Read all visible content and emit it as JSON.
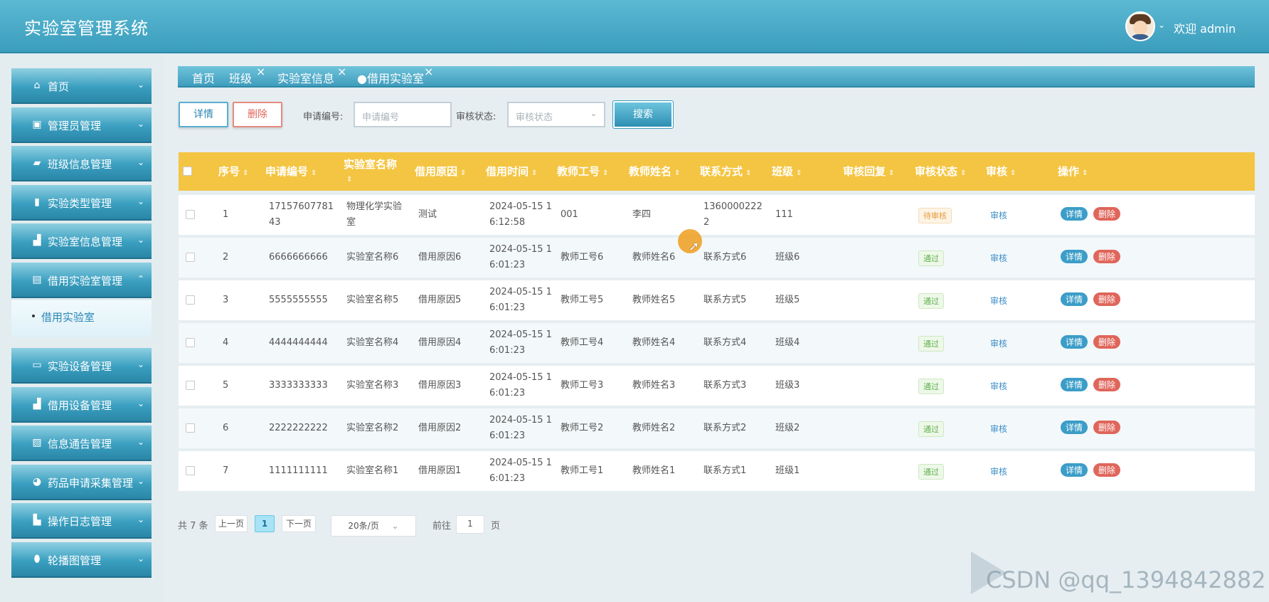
{
  "app": {
    "title": "实验室管理系统",
    "welcome": "欢迎 admin"
  },
  "sidebar": {
    "items": [
      {
        "label": "首页",
        "icon": "home-icon"
      },
      {
        "label": "管理员管理",
        "icon": "chip-icon"
      },
      {
        "label": "班级信息管理",
        "icon": "folder-icon"
      },
      {
        "label": "实验类型管理",
        "icon": "book-icon"
      },
      {
        "label": "实验室信息管理",
        "icon": "chart-icon"
      },
      {
        "label": "借用实验室管理",
        "icon": "panel-icon"
      },
      {
        "label": "实验设备管理",
        "icon": "toolbox-icon"
      },
      {
        "label": "借用设备管理",
        "icon": "chart-icon"
      },
      {
        "label": "信息通告管理",
        "icon": "image-icon"
      },
      {
        "label": "药品申请采集管理",
        "icon": "compass-icon"
      },
      {
        "label": "操作日志管理",
        "icon": "bar-icon"
      },
      {
        "label": "轮播图管理",
        "icon": "capsule-icon"
      }
    ],
    "submenu": "借用实验室"
  },
  "tabs": [
    "首页",
    "班级",
    "实验室信息",
    "借用实验室"
  ],
  "search": {
    "detail": "详情",
    "delete": "删除",
    "app_no_label": "申请编号:",
    "app_no_placeholder": "申请编号",
    "status_label": "审核状态:",
    "status_placeholder": "审核状态",
    "search": "搜索"
  },
  "table": {
    "headers": [
      "序号",
      "申请编号",
      "实验室名称",
      "借用原因",
      "借用时间",
      "教师工号",
      "教师姓名",
      "联系方式",
      "班级",
      "审核回复",
      "审核状态",
      "审核",
      "操作"
    ],
    "rows": [
      {
        "idx": "1",
        "no": "1715760778143",
        "lab": "物理化学实验室",
        "reason": "测试",
        "time": "2024-05-15 16:12:58",
        "tno": "001",
        "tname": "李四",
        "phone": "13600002222",
        "cls": "111",
        "reply": "",
        "status": "待审核",
        "audit": "审核"
      },
      {
        "idx": "2",
        "no": "6666666666",
        "lab": "实验室名称6",
        "reason": "借用原因6",
        "time": "2024-05-15 16:01:23",
        "tno": "教师工号6",
        "tname": "教师姓名6",
        "phone": "联系方式6",
        "cls": "班级6",
        "reply": "",
        "status": "通过",
        "audit": "审核"
      },
      {
        "idx": "3",
        "no": "5555555555",
        "lab": "实验室名称5",
        "reason": "借用原因5",
        "time": "2024-05-15 16:01:23",
        "tno": "教师工号5",
        "tname": "教师姓名5",
        "phone": "联系方式5",
        "cls": "班级5",
        "reply": "",
        "status": "通过",
        "audit": "审核"
      },
      {
        "idx": "4",
        "no": "4444444444",
        "lab": "实验室名称4",
        "reason": "借用原因4",
        "time": "2024-05-15 16:01:23",
        "tno": "教师工号4",
        "tname": "教师姓名4",
        "phone": "联系方式4",
        "cls": "班级4",
        "reply": "",
        "status": "通过",
        "audit": "审核"
      },
      {
        "idx": "5",
        "no": "3333333333",
        "lab": "实验室名称3",
        "reason": "借用原因3",
        "time": "2024-05-15 16:01:23",
        "tno": "教师工号3",
        "tname": "教师姓名3",
        "phone": "联系方式3",
        "cls": "班级3",
        "reply": "",
        "status": "通过",
        "audit": "审核"
      },
      {
        "idx": "6",
        "no": "2222222222",
        "lab": "实验室名称2",
        "reason": "借用原因2",
        "time": "2024-05-15 16:01:23",
        "tno": "教师工号2",
        "tname": "教师姓名2",
        "phone": "联系方式2",
        "cls": "班级2",
        "reply": "",
        "status": "通过",
        "audit": "审核"
      },
      {
        "idx": "7",
        "no": "1111111111",
        "lab": "实验室名称1",
        "reason": "借用原因1",
        "time": "2024-05-15 16:01:23",
        "tno": "教师工号1",
        "tname": "教师姓名1",
        "phone": "联系方式1",
        "cls": "班级1",
        "reply": "",
        "status": "通过",
        "audit": "审核"
      }
    ],
    "action_detail": "详情",
    "action_delete": "删除"
  },
  "pagination": {
    "total": "共 7 条",
    "prev": "上一页",
    "current": "1",
    "next": "下一页",
    "page_size": "20条/页",
    "goto_label": "前往",
    "goto_value": "1",
    "page_suffix": "页"
  },
  "watermark": "CSDN @qq_1394842882",
  "colors": {
    "header": "#3b9dbd",
    "table_header": "#f4c542",
    "pass": "#5eb14a",
    "pending": "#e89b3c",
    "delete": "#e0655a"
  }
}
